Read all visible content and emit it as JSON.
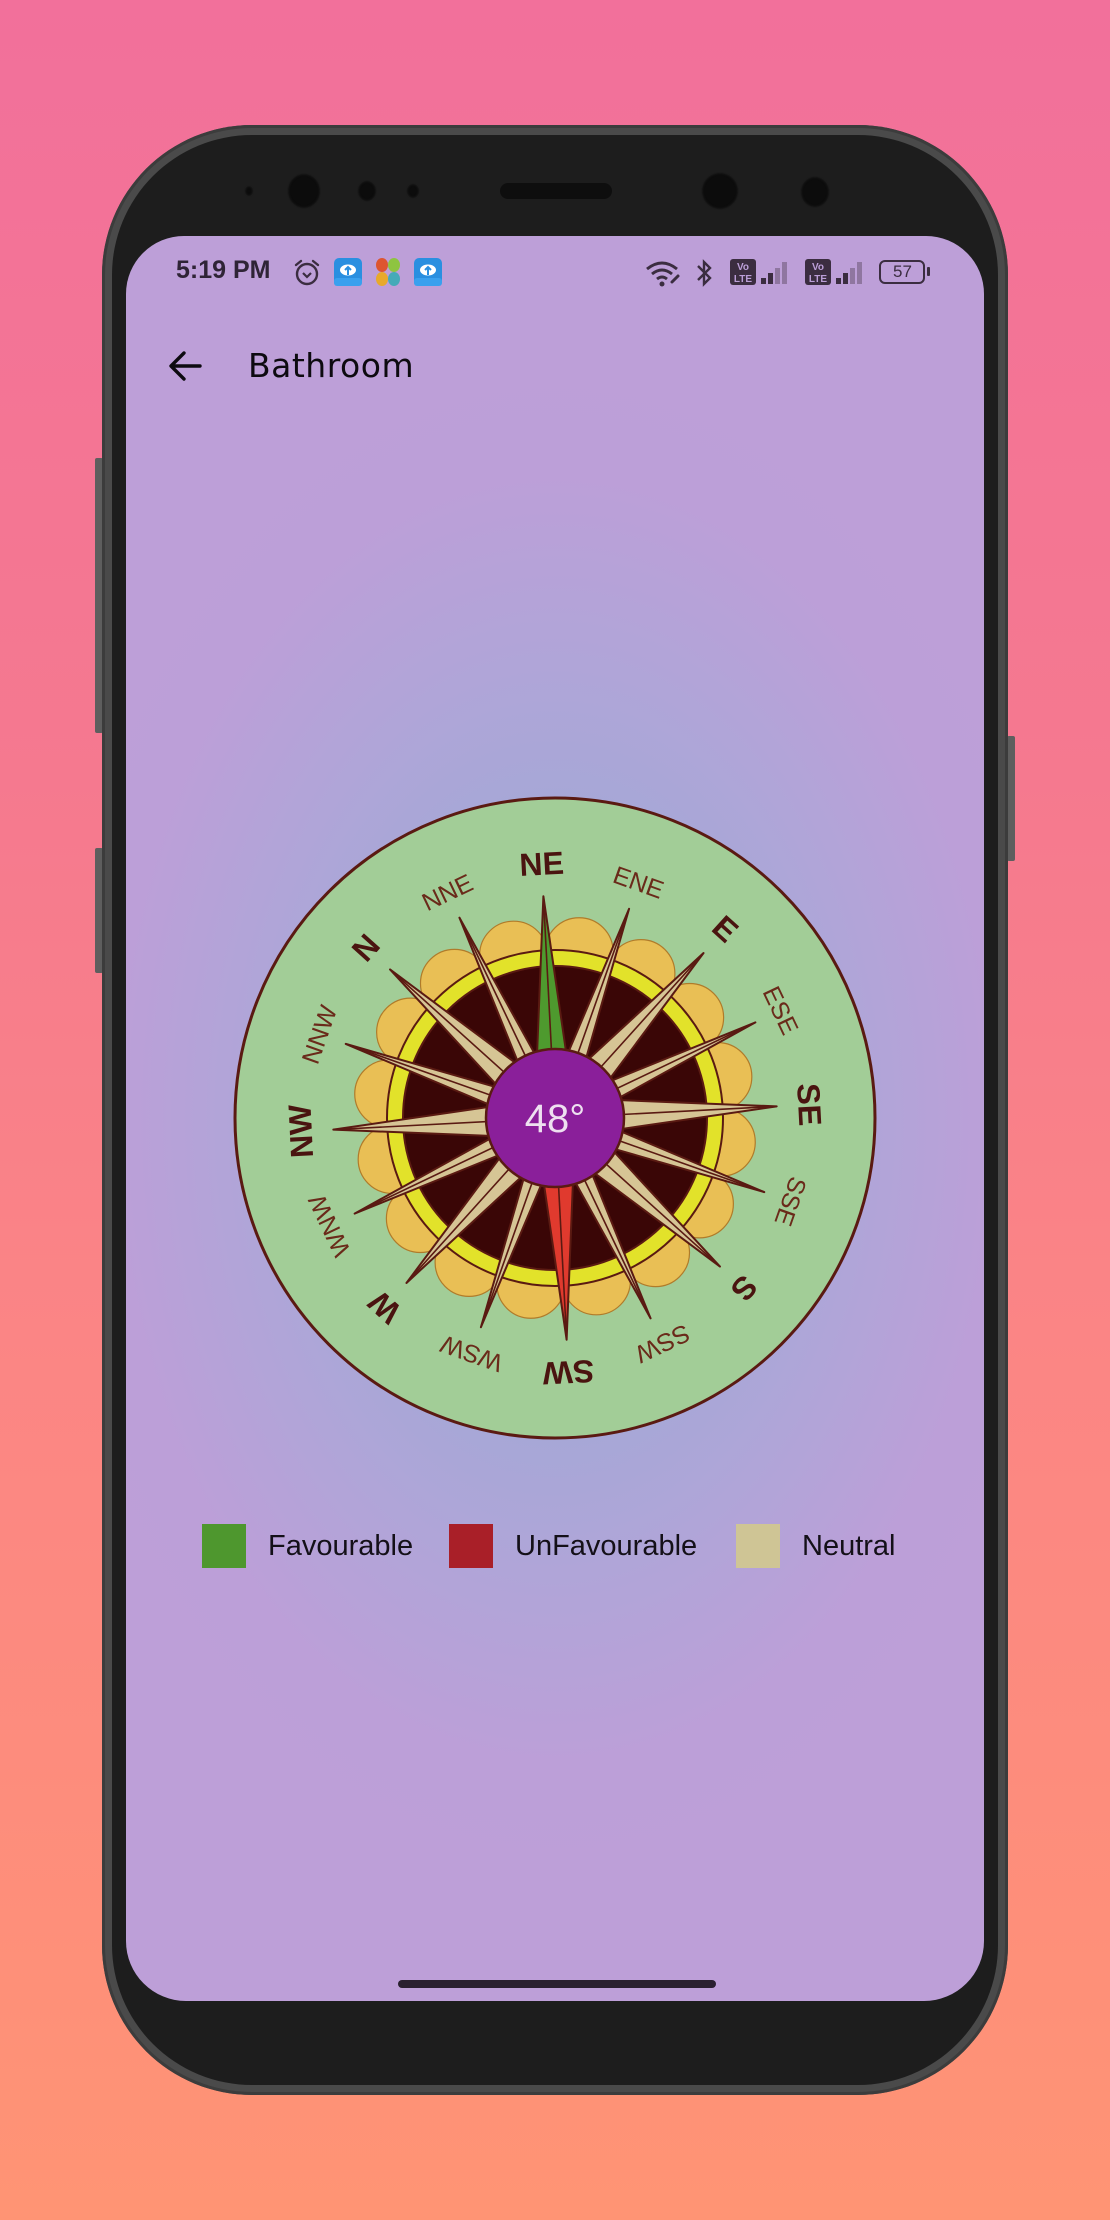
{
  "status_bar": {
    "time": "5:19 PM",
    "left_icons": [
      "alarm-icon",
      "cloud-upload-app-icon",
      "flower-app-icon",
      "cloud-upload-app-icon"
    ],
    "right_icons": [
      "wifi-icon",
      "bluetooth-icon",
      "volte-icon",
      "signal-icon",
      "volte-icon",
      "signal-icon"
    ],
    "volte_label_top": "Vo",
    "volte_label_bottom": "LTE",
    "battery": "57"
  },
  "app_bar": {
    "back_icon": "arrow-left-icon",
    "title": "Bathroom"
  },
  "compass": {
    "heading": "48°",
    "heading_degrees": 48,
    "directions": [
      {
        "label": "N",
        "major": true
      },
      {
        "label": "NNE",
        "major": false
      },
      {
        "label": "NE",
        "major": true
      },
      {
        "label": "ENE",
        "major": false
      },
      {
        "label": "E",
        "major": true
      },
      {
        "label": "ESE",
        "major": false
      },
      {
        "label": "SE",
        "major": true
      },
      {
        "label": "SSE",
        "major": false
      },
      {
        "label": "S",
        "major": true
      },
      {
        "label": "SSW",
        "major": false
      },
      {
        "label": "SW",
        "major": true
      },
      {
        "label": "WSW",
        "major": false
      },
      {
        "label": "W",
        "major": true
      },
      {
        "label": "WNW",
        "major": false
      },
      {
        "label": "NW",
        "major": true
      },
      {
        "label": "NNW",
        "major": false
      }
    ],
    "favourable_direction": "NE",
    "unfavourable_direction": "SW",
    "colors": {
      "face": "#a2cd97",
      "rim": "#5a1a12",
      "center": "#8a1f9a",
      "favourable": "#4e9a2e",
      "unfavourable": "#e03a2e",
      "neutral": "#d6c595",
      "ring_yellow": "#e2e22a",
      "scallop": "#e9bf55",
      "dark_fill": "#3a0606"
    }
  },
  "legend": [
    {
      "label": "Favourable",
      "color": "#4e972e"
    },
    {
      "label": "UnFavourable",
      "color": "#a91f28"
    },
    {
      "label": "Neutral",
      "color": "#cfc595"
    }
  ]
}
